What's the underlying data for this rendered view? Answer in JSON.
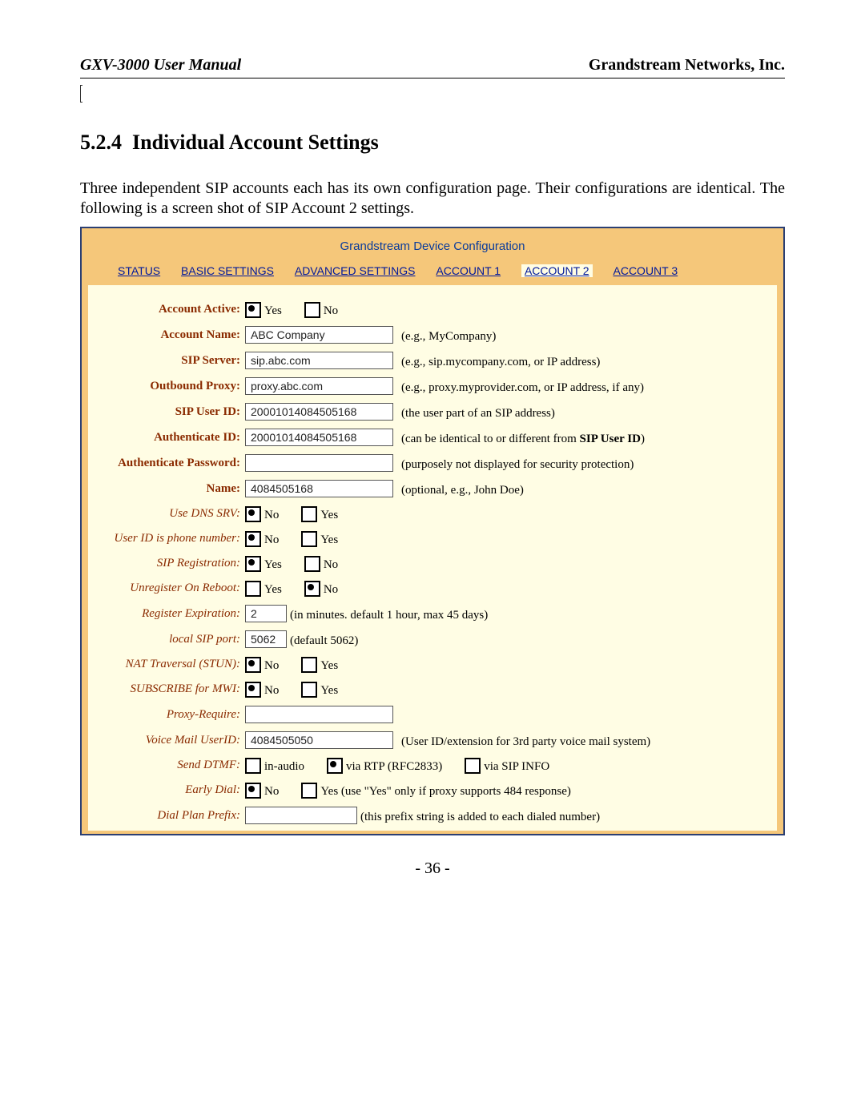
{
  "header": {
    "left": "GXV-3000 User Manual",
    "right": "Grandstream Networks, Inc."
  },
  "section": {
    "number": "5.2.4",
    "title": "Individual Account Settings"
  },
  "body_text": "Three independent SIP accounts each has its own configuration page.  Their configurations are identical. The following is a screen shot of SIP Account 2 settings.",
  "shot_title": "Grandstream Device Configuration",
  "tabs": {
    "status": "STATUS",
    "basic": "BASIC SETTINGS",
    "advanced": "ADVANCED SETTINGS",
    "account1": "ACCOUNT 1",
    "account2": "ACCOUNT 2",
    "account3": "ACCOUNT 3"
  },
  "fields": {
    "account_active": {
      "label": "Account Active:",
      "opt1": "Yes",
      "opt2": "No",
      "selected": "Yes"
    },
    "account_name": {
      "label": "Account Name:",
      "value": "ABC Company",
      "hint": "(e.g., MyCompany)"
    },
    "sip_server": {
      "label": "SIP Server:",
      "value": "sip.abc.com",
      "hint": "(e.g., sip.mycompany.com, or IP address)"
    },
    "outbound_proxy": {
      "label": "Outbound Proxy:",
      "value": "proxy.abc.com",
      "hint": "(e.g., proxy.myprovider.com, or IP address, if any)"
    },
    "sip_user_id": {
      "label": "SIP User ID:",
      "value": "20001014084505168",
      "hint": "(the user part of an SIP address)"
    },
    "auth_id": {
      "label": "Authenticate ID:",
      "value": "20001014084505168",
      "hint_pre": "(can be identical to or different from ",
      "hint_b": "SIP User ID",
      "hint_post": ")"
    },
    "auth_pw": {
      "label": "Authenticate Password:",
      "value": "",
      "hint": "(purposely not displayed for security protection)"
    },
    "name": {
      "label": "Name:",
      "value": "4084505168",
      "hint": "(optional, e.g., John Doe)"
    },
    "use_dns_srv": {
      "label": "Use DNS SRV:",
      "opt1": "No",
      "opt2": "Yes",
      "selected": "No"
    },
    "uid_phone": {
      "label": "User ID is phone number:",
      "opt1": "No",
      "opt2": "Yes",
      "selected": "No"
    },
    "sip_reg": {
      "label": "SIP Registration:",
      "opt1": "Yes",
      "opt2": "No",
      "selected": "Yes"
    },
    "unreg_reboot": {
      "label": "Unregister On Reboot:",
      "opt1": "Yes",
      "opt2": "No",
      "selected": "No"
    },
    "reg_exp": {
      "label": "Register Expiration:",
      "value": "2",
      "hint": "(in minutes. default 1 hour, max 45 days)"
    },
    "local_sip": {
      "label": "local SIP port:",
      "value": "5062",
      "hint": "(default 5062)"
    },
    "nat": {
      "label": "NAT Traversal (STUN):",
      "opt1": "No",
      "opt2": "Yes",
      "selected": "No"
    },
    "sub_mwi": {
      "label": "SUBSCRIBE for MWI:",
      "opt1": "No",
      "opt2": "Yes",
      "selected": "No"
    },
    "proxy_req": {
      "label": "Proxy-Require:",
      "value": ""
    },
    "vm_uid": {
      "label": "Voice Mail UserID:",
      "value": "4084505050",
      "hint": "(User ID/extension for 3rd party voice mail system)"
    },
    "send_dtmf": {
      "label": "Send DTMF:",
      "opt1": "in-audio",
      "opt2": "via RTP (RFC2833)",
      "opt3": "via SIP INFO"
    },
    "early_dial": {
      "label": "Early Dial:",
      "opt1": "No",
      "opt2": "Yes (use \"Yes\" only if proxy supports 484 response)",
      "selected": "No"
    },
    "dial_prefix": {
      "label": "Dial Plan Prefix:",
      "value": "",
      "hint": "(this prefix string is added to each dialed number)"
    }
  },
  "page_number": "- 36 -"
}
